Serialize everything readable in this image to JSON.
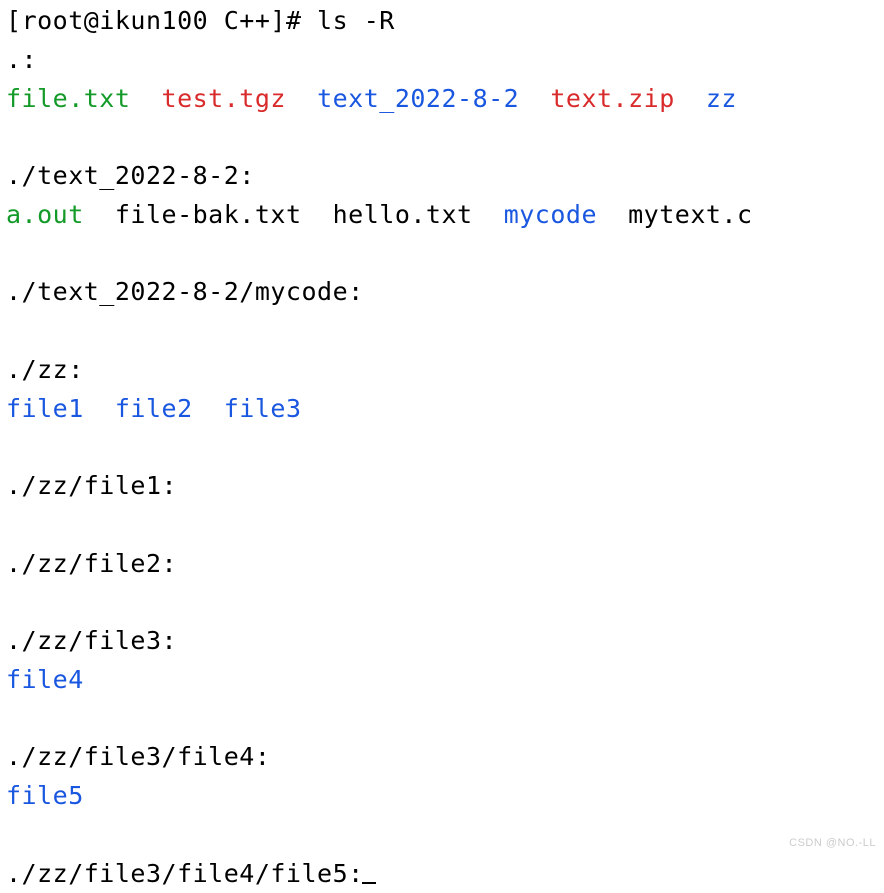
{
  "prompt": {
    "open": "[",
    "userhost": "root@ikun100 ",
    "cwd": "C++",
    "close": "]# ",
    "command": "ls -R"
  },
  "sections": [
    {
      "header": ".:",
      "entries": [
        {
          "name": "file.txt",
          "color": "green"
        },
        {
          "name": "test.tgz",
          "color": "red"
        },
        {
          "name": "text_2022-8-2",
          "color": "blue"
        },
        {
          "name": "text.zip",
          "color": "red"
        },
        {
          "name": "zz",
          "color": "blue"
        }
      ]
    },
    {
      "header": "./text_2022-8-2:",
      "entries": [
        {
          "name": "a.out",
          "color": "green"
        },
        {
          "name": "file-bak.txt",
          "color": "black"
        },
        {
          "name": "hello.txt",
          "color": "black"
        },
        {
          "name": "mycode",
          "color": "blue"
        },
        {
          "name": "mytext.c",
          "color": "black"
        }
      ]
    },
    {
      "header": "./text_2022-8-2/mycode:",
      "entries": []
    },
    {
      "header": "./zz:",
      "entries": [
        {
          "name": "file1",
          "color": "blue"
        },
        {
          "name": "file2",
          "color": "blue"
        },
        {
          "name": "file3",
          "color": "blue"
        }
      ]
    },
    {
      "header": "./zz/file1:",
      "entries": []
    },
    {
      "header": "./zz/file2:",
      "entries": []
    },
    {
      "header": "./zz/file3:",
      "entries": [
        {
          "name": "file4",
          "color": "blue"
        }
      ]
    },
    {
      "header": "./zz/file3/file4:",
      "entries": [
        {
          "name": "file5",
          "color": "blue"
        }
      ]
    },
    {
      "header": "./zz/file3/file4/file5:",
      "entries": [],
      "cursor_after": true
    }
  ],
  "watermark": "CSDN @NO.-LL"
}
